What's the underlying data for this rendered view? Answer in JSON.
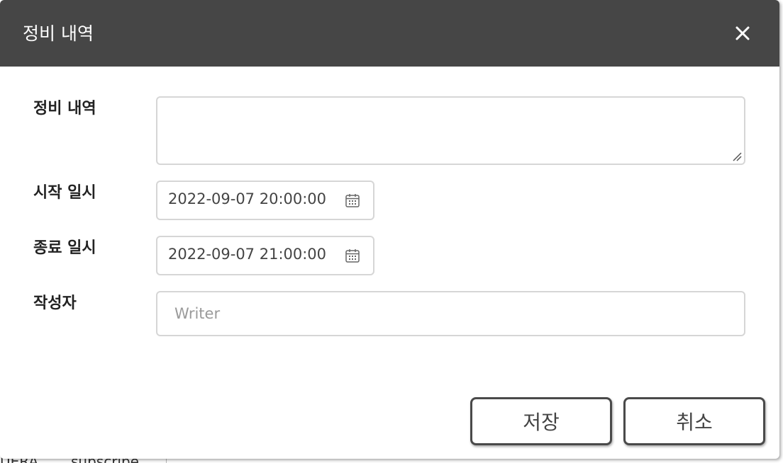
{
  "dialog": {
    "title": "정비 내역",
    "close_icon": "close-icon"
  },
  "form": {
    "details": {
      "label": "정비 내역",
      "value": ""
    },
    "start": {
      "label": "시작 일시",
      "value": "2022-09-07 20:00:00",
      "icon": "calendar-icon"
    },
    "end": {
      "label": "종료 일시",
      "value": "2022-09-07 21:00:00",
      "icon": "calendar-icon"
    },
    "writer": {
      "label": "작성자",
      "value": "",
      "placeholder": "Writer"
    }
  },
  "buttons": {
    "save_label": "저장",
    "cancel_label": "취소"
  },
  "backdrop": {
    "text_left": "UERA",
    "text_right": "subscribe"
  },
  "colors": {
    "header_bg": "#464646",
    "border": "#d6d6d6",
    "button_border": "#4a4a4a"
  }
}
